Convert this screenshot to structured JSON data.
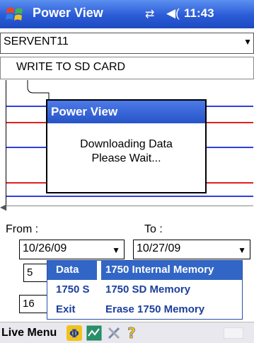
{
  "titlebar": {
    "app_title": "Power View",
    "clock": "11:43",
    "connectivity_icon": "connectivity-arrows",
    "volume_icon": "speaker",
    "start_icon": "windows-flag"
  },
  "device_combo": {
    "value": "SERVENT11"
  },
  "write_button": {
    "label": "WRITE TO SD CARD"
  },
  "dialog": {
    "title": "Power View",
    "message_line1": "Downloading Data",
    "message_line2": "Please Wait..."
  },
  "dates": {
    "from_label": "From :",
    "to_label": "To :",
    "from_value": "10/26/09",
    "to_value": "10/27/09",
    "row2_value": "5",
    "row3_value": "16"
  },
  "menu": {
    "rows": [
      {
        "left": "Data",
        "right": "1750 Internal Memory",
        "selected": true
      },
      {
        "left": "1750 S",
        "right": "1750 SD Memory",
        "selected": false
      },
      {
        "left": "Exit",
        "right": "Erase 1750 Memory",
        "selected": false
      }
    ]
  },
  "bottombar": {
    "live_menu_label": "Live Menu"
  },
  "colors": {
    "titlebar": "#2a5bd6",
    "graph_blue": "#2f3fe0",
    "graph_red": "#e02020",
    "menu_selected": "#3266c6",
    "menu_text": "#1b3f9c"
  }
}
